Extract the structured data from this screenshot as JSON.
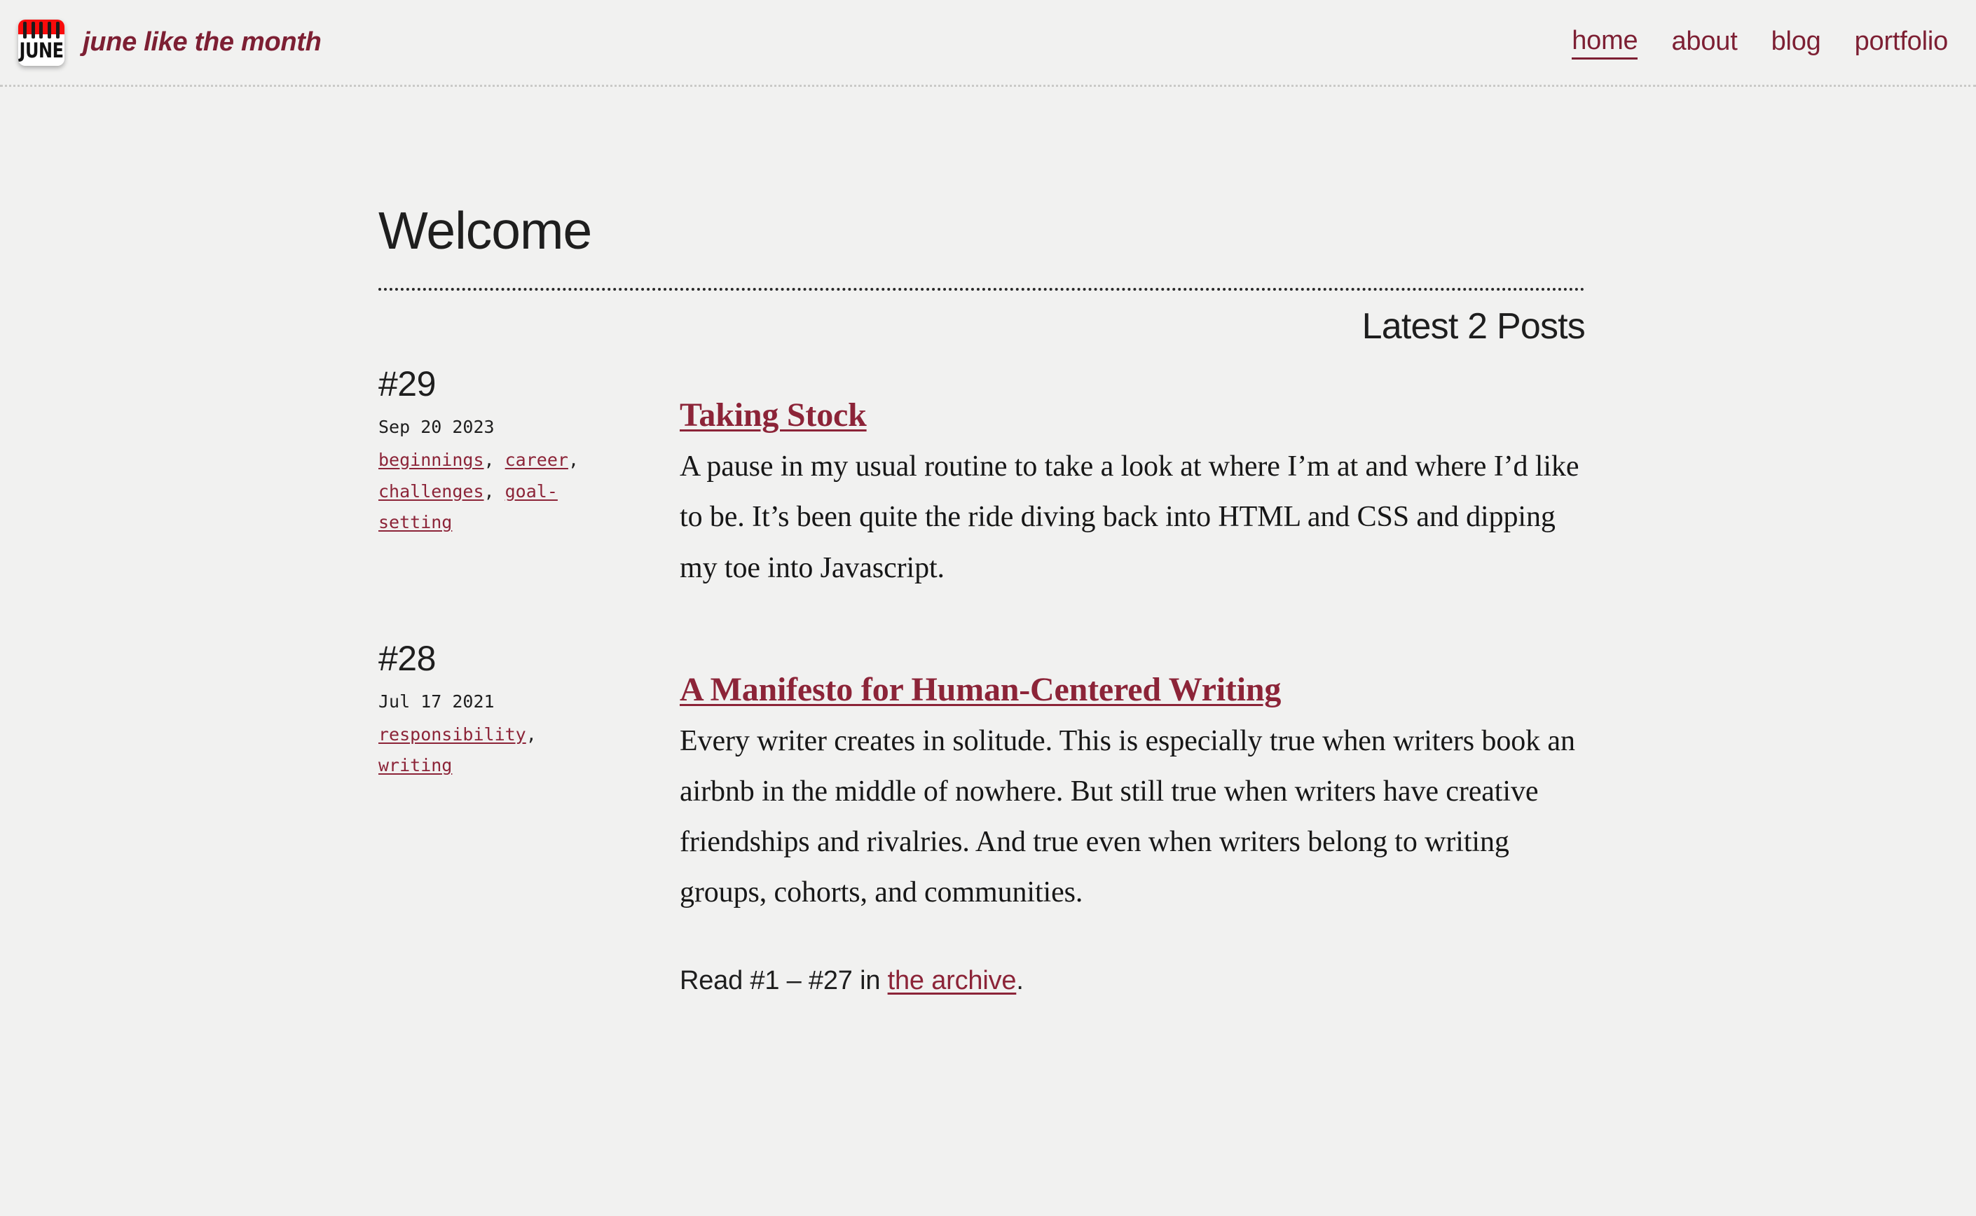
{
  "colors": {
    "background": "#f1f1f0",
    "accent_dark_red": "#7d1f33",
    "link_red": "#8c2438",
    "favicon_band_red": "#f90b0b",
    "text": "#1e1e1e",
    "header_rule": "#c9c9c7",
    "title_rule": "#2a2a2a"
  },
  "header": {
    "logo": {
      "icon_name": "calendar-favicon",
      "word": "JUNE",
      "ring_count": 5
    },
    "site_title": "june like the month",
    "nav": [
      {
        "label": "home",
        "active": true
      },
      {
        "label": "about",
        "active": false
      },
      {
        "label": "blog",
        "active": false
      },
      {
        "label": "portfolio",
        "active": false
      }
    ]
  },
  "main": {
    "page_title": "Welcome",
    "latest_heading": "Latest 2 Posts",
    "posts": [
      {
        "number": "#29",
        "date": "Sep 20 2023",
        "tags": [
          "beginnings",
          "career",
          "challenges",
          "goal-setting"
        ],
        "title": "Taking Stock",
        "excerpt": "A pause in my usual routine to take a look at where I’m at and where I’d like to be. It’s been quite the ride diving back into HTML and CSS and dipping my toe into Javascript."
      },
      {
        "number": "#28",
        "date": "Jul 17 2021",
        "tags": [
          "responsibility",
          "writing"
        ],
        "title": "A Manifesto for Human-Centered Writing",
        "excerpt": "Every writer creates in solitude. This is especially true when writers book an airbnb in the middle of nowhere. But still true when writers have creative friendships and rivalries. And true even when writers belong to writing groups, cohorts, and communities."
      }
    ],
    "archive": {
      "prefix": "Read #1 – #27 in ",
      "link_label": "the archive",
      "suffix": "."
    }
  }
}
